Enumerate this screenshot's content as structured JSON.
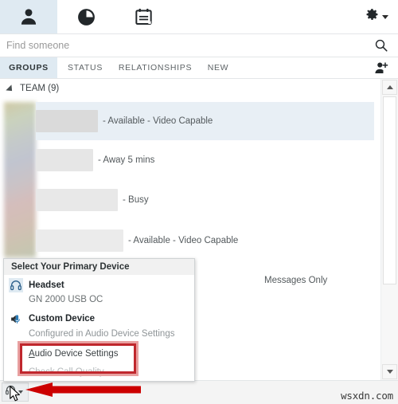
{
  "navbar": {
    "tabs": [
      {
        "name": "contacts",
        "icon": "person-icon",
        "selected": true
      },
      {
        "name": "conversations",
        "icon": "clock-icon",
        "selected": false
      },
      {
        "name": "meetings",
        "icon": "calendar-icon",
        "selected": false
      }
    ],
    "settings": {
      "icon": "gear-icon",
      "caret": "chevron-down-icon"
    }
  },
  "search": {
    "placeholder": "Find someone",
    "value": "",
    "icon": "search-icon"
  },
  "tabstrip": {
    "tabs": [
      {
        "label": "GROUPS",
        "selected": true
      },
      {
        "label": "STATUS",
        "selected": false
      },
      {
        "label": "RELATIONSHIPS",
        "selected": false
      },
      {
        "label": "NEW",
        "selected": false
      }
    ],
    "add_contact_icon": "add-contact-icon"
  },
  "contact_list": {
    "group": {
      "label": "TEAM (9)",
      "expanded": true
    },
    "contacts": [
      {
        "name": "",
        "name_redacted_width": 78,
        "status": "- Available - Video Capable",
        "selected": true
      },
      {
        "name": "",
        "name_redacted_width": 72,
        "status": "- Away 5 mins",
        "selected": false
      },
      {
        "name": "",
        "name_redacted_width": 103,
        "status": "- Busy",
        "selected": false
      },
      {
        "name": "",
        "name_redacted_width": 110,
        "status": "- Available - Video Capable",
        "selected": false
      },
      {
        "name": "",
        "name_redacted_width": 90,
        "status": "Messages Only",
        "selected": false
      }
    ]
  },
  "scrollbar": {
    "up_icon": "scroll-up-icon",
    "down_icon": "scroll-down-icon"
  },
  "popup": {
    "title": "Select Your Primary Device",
    "devices": [
      {
        "label": "Headset",
        "sublabel": "GN 2000 USB OC",
        "icon": "headset-icon",
        "selected": true
      },
      {
        "label": "Custom Device",
        "sublabel": "Configured in Audio Device Settings",
        "icon": "speaker-mic-icon",
        "selected": false
      }
    ],
    "actions": [
      {
        "label": "Audio Device Settings",
        "accel": "A",
        "disabled": false,
        "highlighted": true
      },
      {
        "label": "Check Call Quality",
        "accel": "",
        "disabled": true,
        "highlighted": false
      }
    ]
  },
  "statusbar": {
    "device_button": {
      "icon": "headset-icon",
      "caret": "chevron-down-icon"
    },
    "watermark": "wsxdn.com"
  },
  "annotations": {
    "highlight_color": "#c0272d",
    "arrow_color": "#cc0000",
    "cursor": "mouse-pointer-icon"
  }
}
